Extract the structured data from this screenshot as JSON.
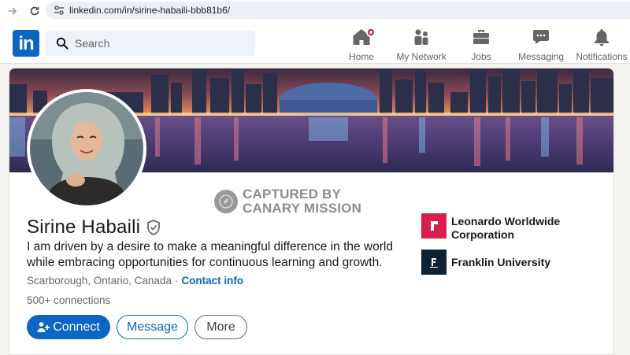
{
  "browser": {
    "url": "linkedin.com/in/sirine-habaili-bbb81b6/"
  },
  "nav": {
    "logo_text": "in",
    "search_placeholder": "Search",
    "items": [
      {
        "label": "Home",
        "icon": "home-icon"
      },
      {
        "label": "My Network",
        "icon": "network-icon"
      },
      {
        "label": "Jobs",
        "icon": "briefcase-icon"
      },
      {
        "label": "Messaging",
        "icon": "message-icon"
      },
      {
        "label": "Notifications",
        "icon": "bell-icon"
      }
    ]
  },
  "profile": {
    "watermark_line1": "CAPTURED BY",
    "watermark_line2": "CANARY MISSION",
    "name": "Sirine Habaili",
    "headline": "I am driven by a desire to make a meaningful difference in the world while embracing opportunities for continuous learning and growth.",
    "location": "Scarborough, Ontario, Canada",
    "separator": "·",
    "contact_info": "Contact info",
    "connections": "500+ connections",
    "actions": {
      "connect": "Connect",
      "message": "Message",
      "more": "More"
    },
    "experience": [
      {
        "name": "Leonardo Worldwide Corporation",
        "logo_color": "#d81f4b"
      },
      {
        "name": "Franklin University",
        "logo_color": "#0f2235"
      }
    ]
  },
  "colors": {
    "brand": "#0a66c2",
    "notification": "#cb112d"
  }
}
